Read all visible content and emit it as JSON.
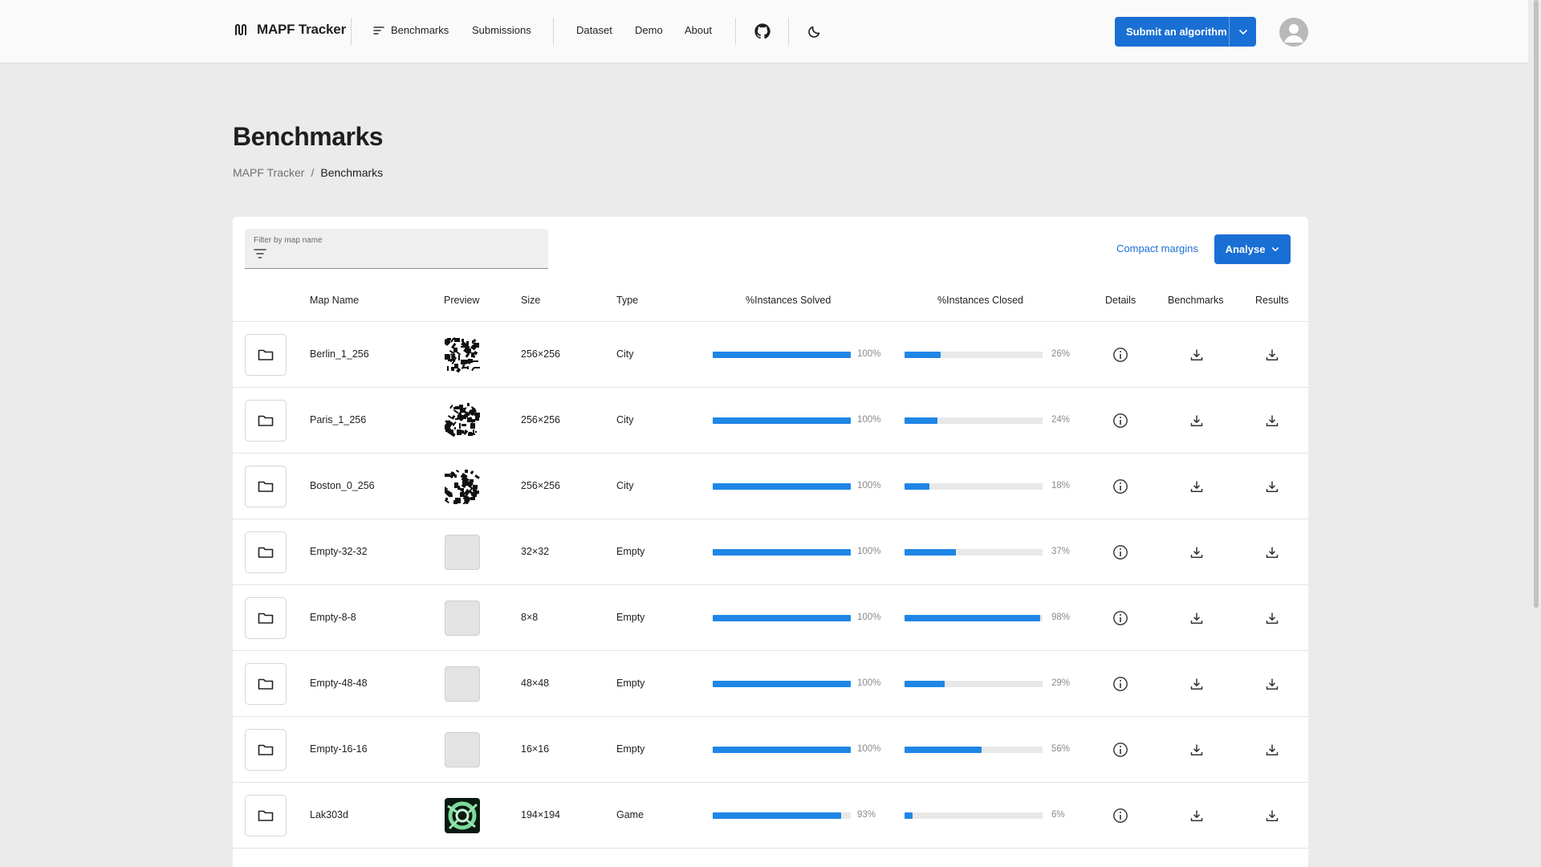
{
  "header": {
    "brand": "MAPF Tracker",
    "nav": [
      {
        "label": "Benchmarks",
        "icon": "sort-lines-icon"
      },
      {
        "label": "Submissions"
      },
      {
        "label": "Dataset"
      },
      {
        "label": "Demo"
      },
      {
        "label": "About"
      }
    ],
    "github_icon": "github-icon",
    "theme_icon": "moon-icon",
    "submit_label": "Submit an algorithm",
    "avatar_icon": "user-avatar-icon"
  },
  "page": {
    "title": "Benchmarks",
    "breadcrumb": [
      "MAPF Tracker",
      "/",
      "Benchmarks"
    ]
  },
  "toolbar": {
    "filter_placeholder": "Filter by map name",
    "filter_value": "",
    "compact_label": "Compact margins",
    "analyse_label": "Analyse"
  },
  "table": {
    "columns": [
      "Map Name",
      "Preview",
      "Size",
      "Type",
      "%Instances Solved",
      "%Instances Closed",
      "Details",
      "Benchmarks",
      "Results"
    ],
    "rows": [
      {
        "name": "Berlin_1_256",
        "preview": "city",
        "size": "256×256",
        "type": "City",
        "solved": 100,
        "solved_label": "100%",
        "closed": 26,
        "closed_label": "26%"
      },
      {
        "name": "Paris_1_256",
        "preview": "city",
        "size": "256×256",
        "type": "City",
        "solved": 100,
        "solved_label": "100%",
        "closed": 24,
        "closed_label": "24%"
      },
      {
        "name": "Boston_0_256",
        "preview": "city",
        "size": "256×256",
        "type": "City",
        "solved": 100,
        "solved_label": "100%",
        "closed": 18,
        "closed_label": "18%"
      },
      {
        "name": "Empty-32-32",
        "preview": "empty",
        "size": "32×32",
        "type": "Empty",
        "solved": 100,
        "solved_label": "100%",
        "closed": 37,
        "closed_label": "37%"
      },
      {
        "name": "Empty-8-8",
        "preview": "empty",
        "size": "8×8",
        "type": "Empty",
        "solved": 100,
        "solved_label": "100%",
        "closed": 98,
        "closed_label": "98%"
      },
      {
        "name": "Empty-48-48",
        "preview": "empty",
        "size": "48×48",
        "type": "Empty",
        "solved": 100,
        "solved_label": "100%",
        "closed": 29,
        "closed_label": "29%"
      },
      {
        "name": "Empty-16-16",
        "preview": "empty",
        "size": "16×16",
        "type": "Empty",
        "solved": 100,
        "solved_label": "100%",
        "closed": 56,
        "closed_label": "56%"
      },
      {
        "name": "Lak303d",
        "preview": "game",
        "size": "194×194",
        "type": "Game",
        "solved": 93,
        "solved_label": "93%",
        "closed": 6,
        "closed_label": "6%"
      }
    ],
    "icons": {
      "row": "folder-icon",
      "details": "info-icon",
      "download": "download-icon"
    }
  },
  "colors": {
    "accent": "#1a6fd4",
    "progress": "#1f86e6",
    "background": "#ebebeb"
  }
}
